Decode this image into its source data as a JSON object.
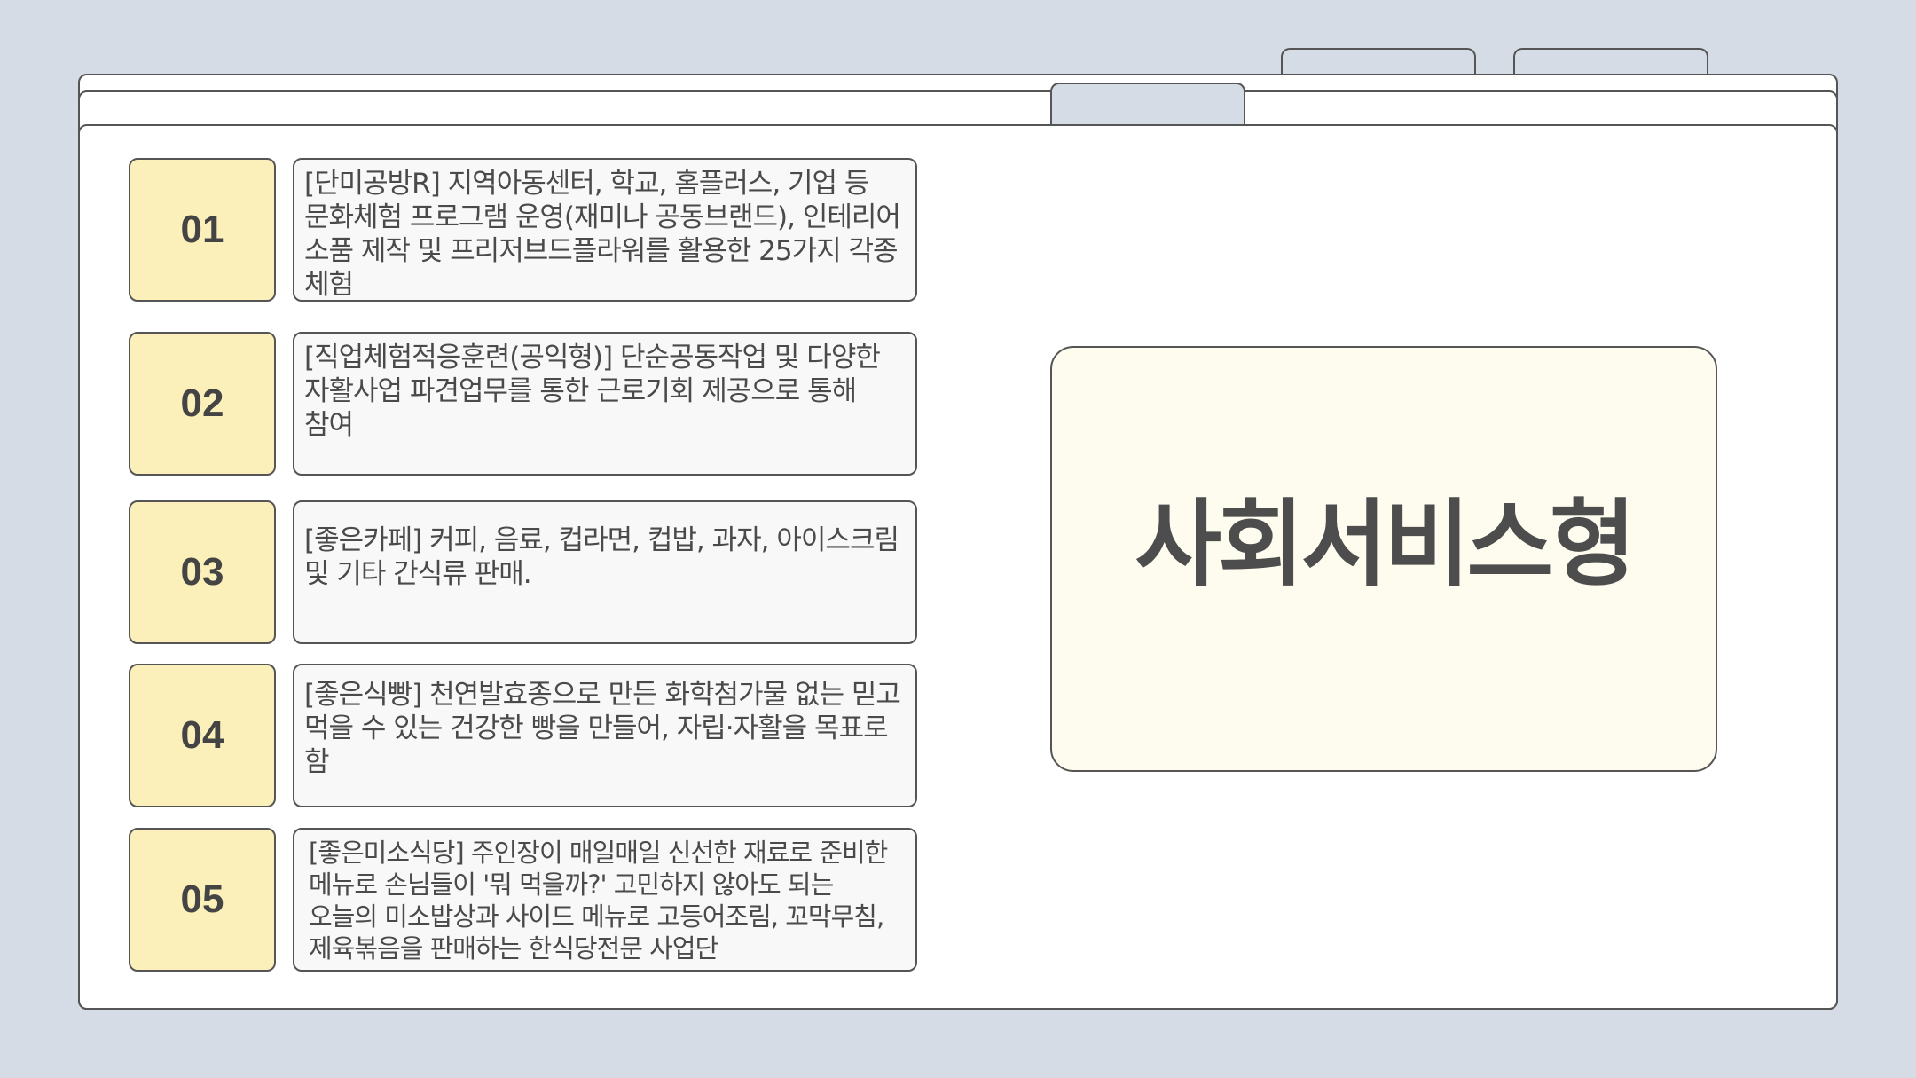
{
  "items": [
    {
      "number": "01",
      "text": "[단미공방R] 지역아동센터, 학교, 홈플러스, 기업 등 문화체험 프로그램 운영(재미나 공동브랜드), 인테리어 소품 제작 및 프리저브드플라워를 활용한 25가지 각종 체험"
    },
    {
      "number": "02",
      "text": "[직업체험적응훈련(공익형)] 단순공동작업 및 다양한 자활사업 파견업무를 통한 근로기회 제공으로 통해 참여"
    },
    {
      "number": "03",
      "text": "[좋은카페] 커피, 음료, 컵라면, 컵밥, 과자, 아이스크림 및 기타 간식류 판매."
    },
    {
      "number": "04",
      "text": "[좋은식빵] 천연발효종으로 만든 화학첨가물 없는 믿고 먹을 수 있는 건강한 빵을 만들어, 자립·자활을 목표로 함"
    },
    {
      "number": "05",
      "text": "[좋은미소식당] 주인장이 매일매일 신선한 재료로 준비한 메뉴로 손님들이 '뭐 먹을까?' 고민하지 않아도 되는 오늘의 미소밥상과 사이드 메뉴로 고등어조림, 꼬막무침, 제육볶음을 판매하는 한식당전문 사업단"
    }
  ],
  "panel": {
    "title": "사회서비스형"
  },
  "colors": {
    "background": "#d5dce6",
    "number_box": "#fbf0b9",
    "text_box": "#f8f8f8",
    "panel": "#fdfcee",
    "border": "#555555"
  }
}
